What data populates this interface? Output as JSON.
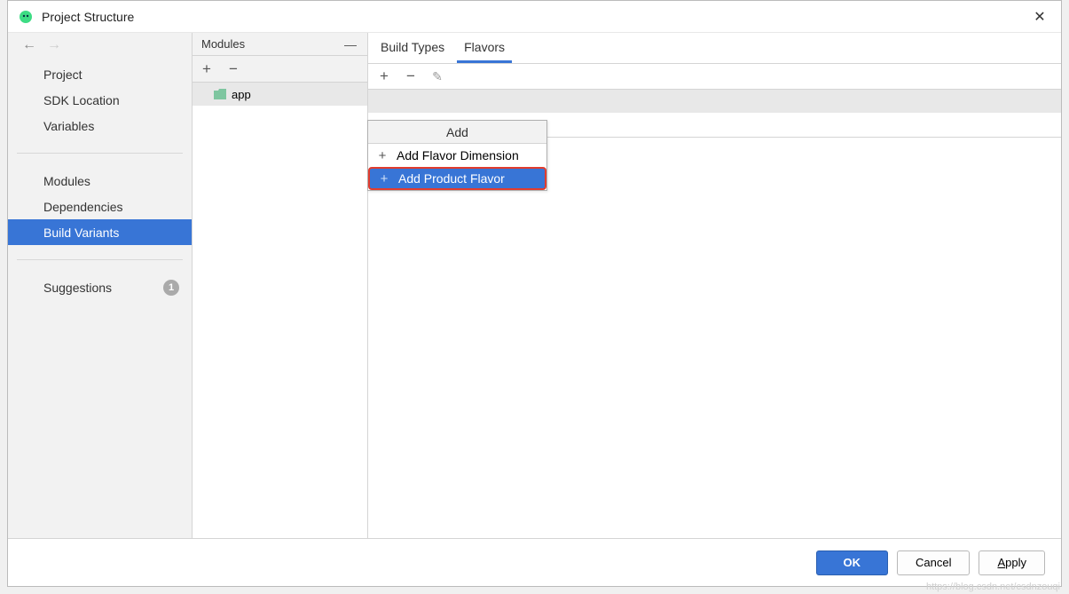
{
  "title": "Project Structure",
  "sidebar": {
    "group1": [
      {
        "label": "Project"
      },
      {
        "label": "SDK Location"
      },
      {
        "label": "Variables"
      }
    ],
    "group2": [
      {
        "label": "Modules"
      },
      {
        "label": "Dependencies"
      },
      {
        "label": "Build Variants"
      }
    ],
    "group3": [
      {
        "label": "Suggestions",
        "badge": "1"
      }
    ]
  },
  "modules": {
    "header": "Modules",
    "items": [
      {
        "name": "app"
      }
    ]
  },
  "tabs": [
    {
      "label": "Build Types"
    },
    {
      "label": "Flavors"
    }
  ],
  "popup": {
    "title": "Add",
    "items": [
      {
        "label": "Add Flavor Dimension"
      },
      {
        "label": "Add Product Flavor"
      }
    ]
  },
  "buttons": {
    "ok": "OK",
    "cancel": "Cancel",
    "apply": "Apply"
  },
  "watermark": "https://blog.csdn.net/csdnzouqi"
}
